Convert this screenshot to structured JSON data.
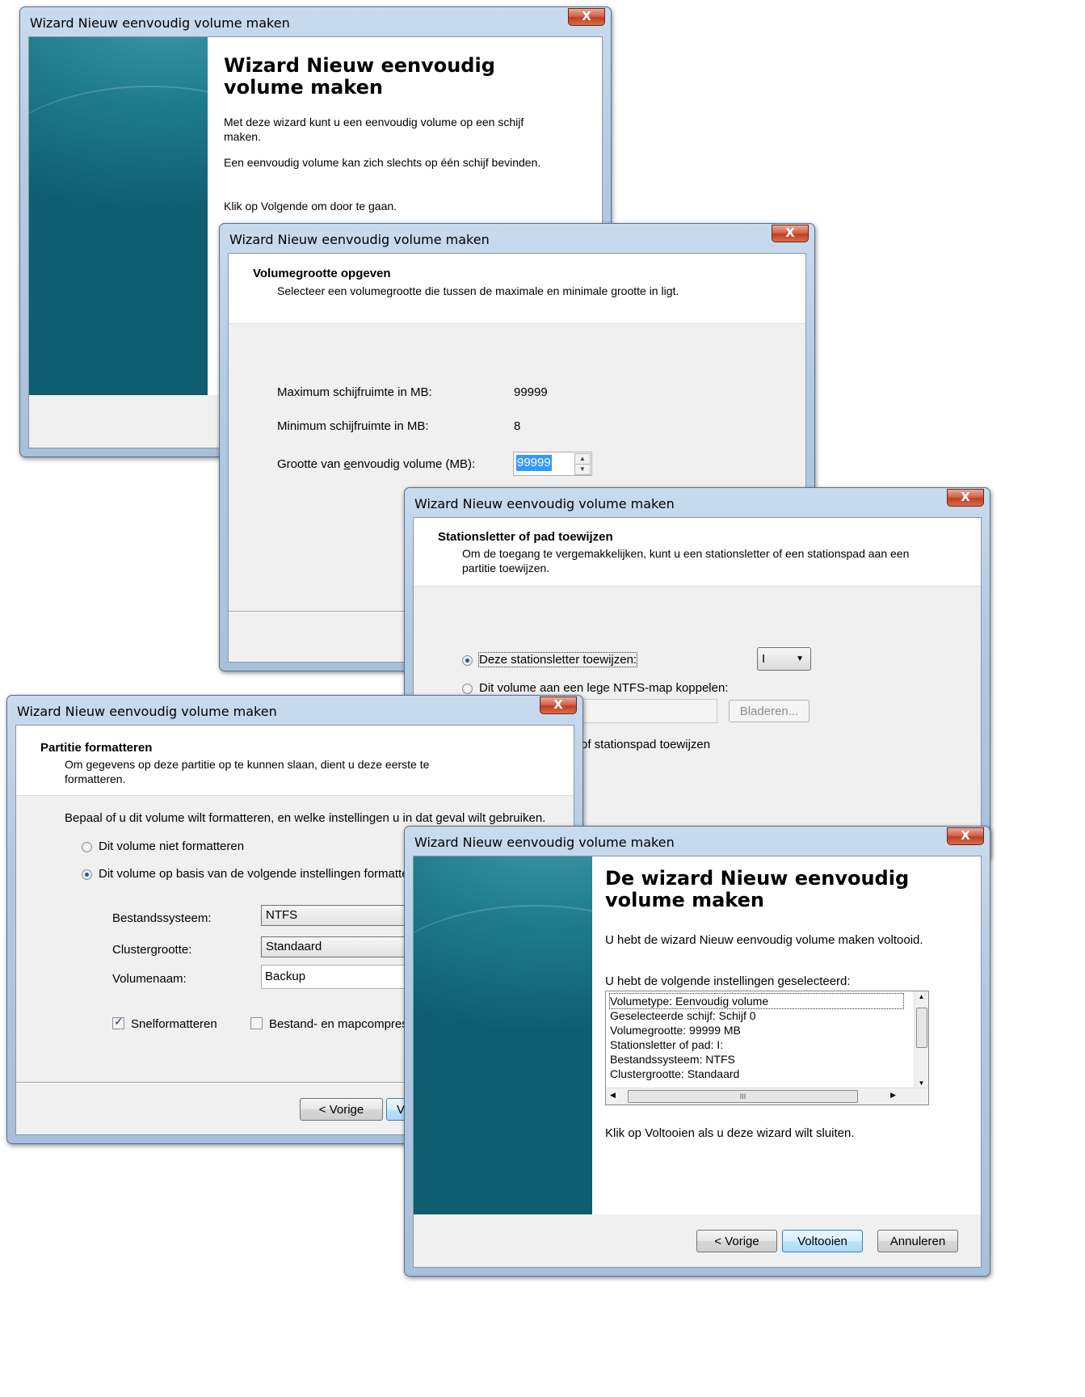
{
  "window_title": "Wizard Nieuw eenvoudig volume maken",
  "close_glyph": "X",
  "welcome": {
    "heading": "Wizard Nieuw eenvoudig volume maken",
    "text1": "Met deze wizard kunt u een eenvoudig volume op een schijf maken.",
    "text2": "Een eenvoudig volume kan zich slechts op één schijf bevinden.",
    "text3": "Klik op Volgende om door te gaan."
  },
  "size": {
    "heading": "Volumegrootte opgeven",
    "subheading": "Selecteer een volumegrootte die tussen de maximale en minimale grootte in ligt.",
    "max_label": "Maximum schijfruimte in MB:",
    "max_value": "99999",
    "min_label": "Minimum schijfruimte in MB:",
    "min_value": "8",
    "size_label_pre": "Grootte van ",
    "size_label_u": "e",
    "size_label_post": "envoudig volume (MB):",
    "size_value": "99999"
  },
  "letter": {
    "heading": "Stationsletter of pad toewijzen",
    "subheading": "Om de toegang te vergemakkelijken, kunt u een stationsletter of een stationspad aan een partitie toewijzen.",
    "opt1": "Deze stationsletter toewijzen:",
    "opt1_value": "I",
    "opt2": "Dit volume aan een lege NTFS-map koppelen:",
    "browse_label": "Bladeren...",
    "opt3_partial": "of stationspad toewijzen"
  },
  "format": {
    "heading": "Partitie formatteren",
    "subheading": "Om gegevens op deze partitie op te kunnen slaan, dient u deze eerste te formatteren.",
    "instruction": "Bepaal of u dit volume wilt formatteren, en welke instellingen u in dat geval wilt gebruiken.",
    "opt_no": "Dit volume niet formatteren",
    "opt_yes": "Dit volume op basis van de volgende instellingen formatteren:",
    "fs_label": "Bestandssysteem:",
    "fs_value": "NTFS",
    "cluster_label": "Clustergrootte:",
    "cluster_value": "Standaard",
    "volname_label": "Volumenaam:",
    "volname_value": "Backup",
    "quick_label": "Snelformatteren",
    "compress_label": "Bestand- en mapcompressie inschakelen",
    "back_button": "< Vorige",
    "next_partial": "Vo"
  },
  "finish": {
    "heading": "De wizard Nieuw eenvoudig volume maken",
    "done_text": "U hebt de wizard Nieuw eenvoudig volume maken voltooid.",
    "settings_intro": "U hebt de volgende instellingen geselecteerd:",
    "settings": [
      "Volumetype: Eenvoudig volume",
      "Geselecteerde schijf: Schijf 0",
      "Volumegrootte: 99999 MB",
      "Stationsletter of pad: I:",
      "Bestandssysteem: NTFS",
      "Clustergrootte: Standaard"
    ],
    "scroll_grip": "III",
    "close_text": "Klik op Voltooien als u deze wizard wilt sluiten.",
    "back_button": "< Vorige",
    "finish_button": "Voltooien",
    "cancel_button": "Annuleren"
  }
}
